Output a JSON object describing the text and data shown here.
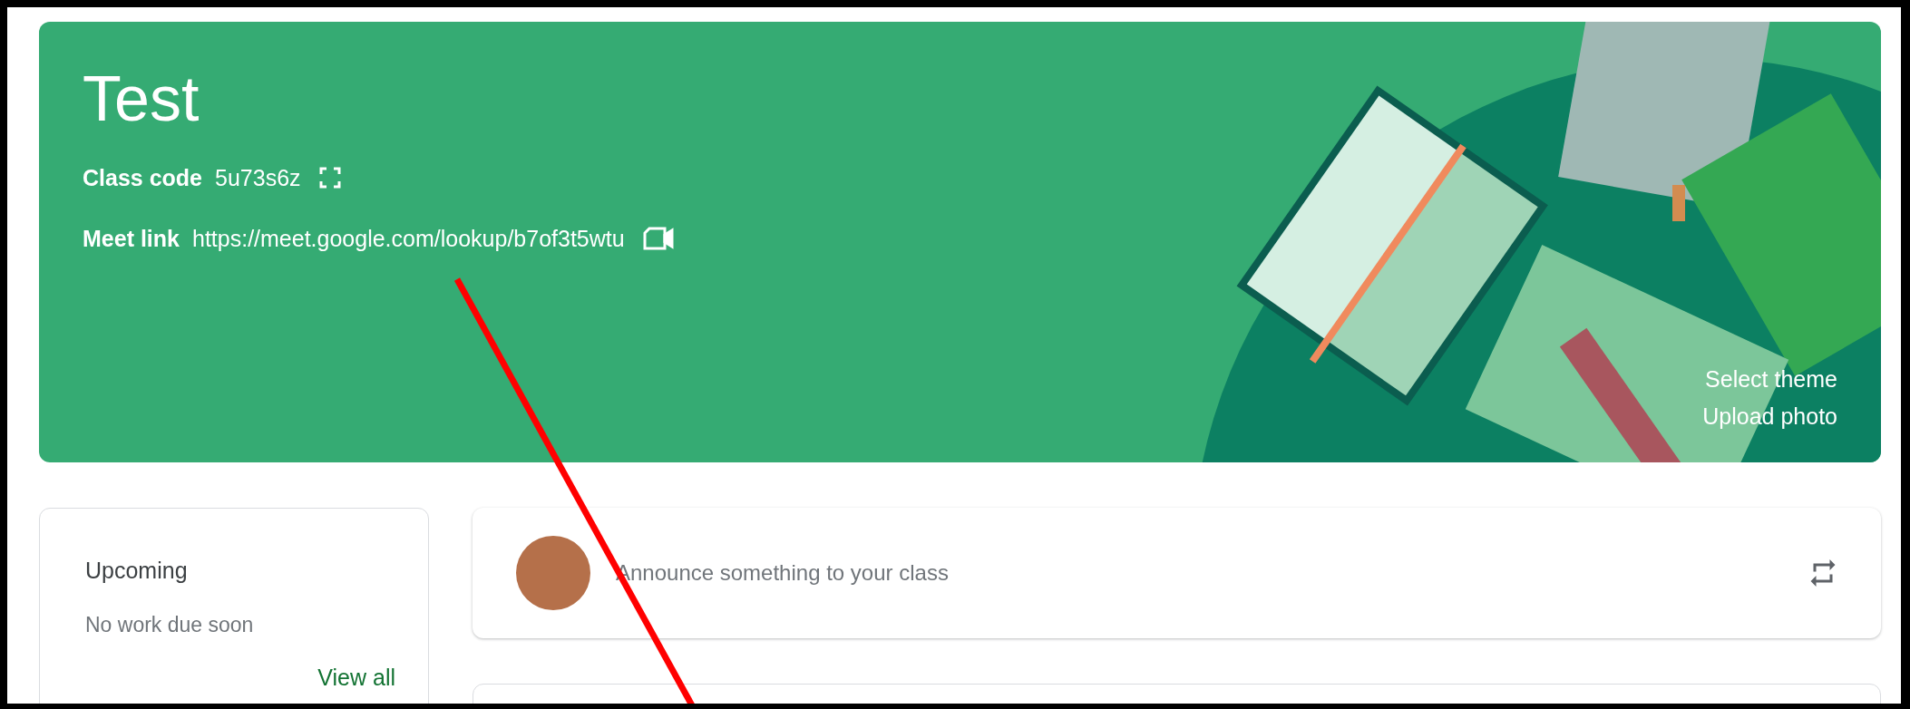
{
  "class": {
    "title": "Test",
    "class_code_label": "Class code",
    "class_code": "5u73s6z",
    "meet_link_label": "Meet link",
    "meet_link": "https://meet.google.com/lookup/b7of3t5wtu",
    "theme_actions": [
      "Select theme",
      "Upload photo"
    ]
  },
  "upcoming": {
    "title": "Upcoming",
    "empty_message": "No work due soon",
    "view_all": "View all"
  },
  "announce": {
    "placeholder": "Announce something to your class"
  }
}
